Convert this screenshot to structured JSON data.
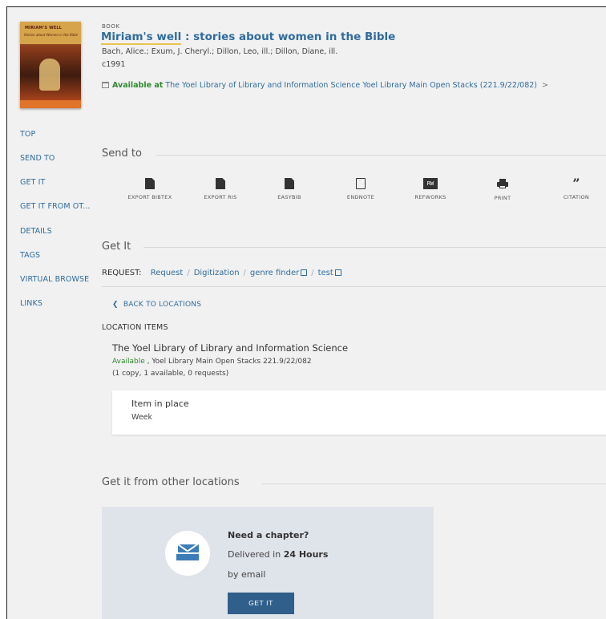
{
  "record": {
    "type": "BOOK",
    "title_highlight": "Miriam's well",
    "title_rest": " : stories about women in the Bible",
    "authors": "Bach, Alice.; Exum, J. Cheryl.; Dillon, Leo, ill.; Dillon, Diane, ill.",
    "date": "c1991",
    "availability_status": "Available at",
    "availability_library": "The Yoel Library of Library and Information Science",
    "availability_location": "Yoel Library Main Open Stacks (221.9/22/082)",
    "availability_chevron": ">",
    "cover_title": "MIRIAM'S WELL",
    "cover_subtitle": "Stories about Women in the Bible"
  },
  "sidenav": {
    "items": [
      "TOP",
      "SEND TO",
      "GET IT",
      "GET IT FROM OT...",
      "DETAILS",
      "TAGS",
      "VIRTUAL BROWSE",
      "LINKS"
    ]
  },
  "send_to": {
    "heading": "Send to",
    "actions": [
      {
        "label": "EXPORT BIBTEX",
        "icon": "bibtex-icon"
      },
      {
        "label": "EXPORT RIS",
        "icon": "ris-icon"
      },
      {
        "label": "EASYBIB",
        "icon": "easybib-icon"
      },
      {
        "label": "ENDNOTE",
        "icon": "endnote-icon"
      },
      {
        "label": "REFWORKS",
        "icon": "refworks-icon",
        "icon_text": "RW"
      },
      {
        "label": "PRINT",
        "icon": "print-icon"
      },
      {
        "label": "CITATION",
        "icon": "quote-icon",
        "icon_text": "”"
      }
    ]
  },
  "get_it": {
    "heading": "Get It",
    "request_label": "REQUEST:",
    "request_links": [
      "Request",
      "Digitization",
      "genre finder",
      "test"
    ],
    "back_label": "BACK TO LOCATIONS",
    "location_items_label": "LOCATION ITEMS",
    "location_name": "The Yoel Library of Library and Information Science",
    "location_status": "Available",
    "location_detail": " , Yoel Library Main Open Stacks 221.9/22/082",
    "copies": "(1 copy, 1 available, 0 requests)",
    "item_status": "Item in place",
    "item_policy": "Week"
  },
  "other_locations": {
    "heading": "Get it from other locations",
    "card_title": "Need a chapter?",
    "delivered_prefix": "Delivered in ",
    "delivered_time": "24 Hours",
    "by": "by email",
    "button": "GET IT"
  },
  "colors": {
    "link": "#2f6c9e",
    "available": "#2e8b2e",
    "button": "#2f5f8a"
  }
}
